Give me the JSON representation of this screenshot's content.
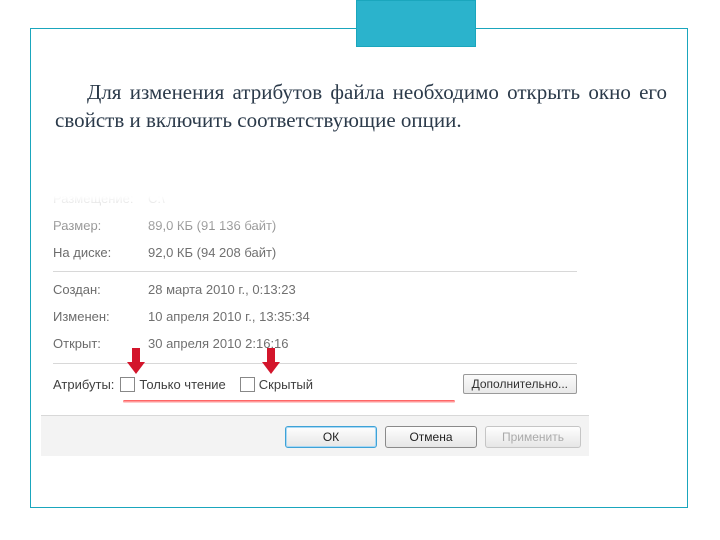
{
  "intro": "Для изменения атрибутов файла необходимо открыть окно его свойств и включить соответствующие опции.",
  "props": {
    "location": {
      "label": "Размещение:",
      "value": "C:\\"
    },
    "size": {
      "label": "Размер:",
      "value": "89,0 КБ (91 136 байт)"
    },
    "disk": {
      "label": "На диске:",
      "value": "92,0 КБ (94 208 байт)"
    },
    "created": {
      "label": "Создан:",
      "value": "28 марта 2010 г., 0:13:23"
    },
    "modified": {
      "label": "Изменен:",
      "value": "10 апреля 2010 г., 13:35:34"
    },
    "opened": {
      "label": "Открыт:",
      "value": "30 апреля 2010     2:16:16"
    }
  },
  "attrs": {
    "label": "Атрибуты:",
    "readonly": "Только чтение",
    "hidden": "Скрытый",
    "more": "Дополнительно..."
  },
  "buttons": {
    "ok": "ОК",
    "cancel": "Отмена",
    "apply": "Применить"
  }
}
